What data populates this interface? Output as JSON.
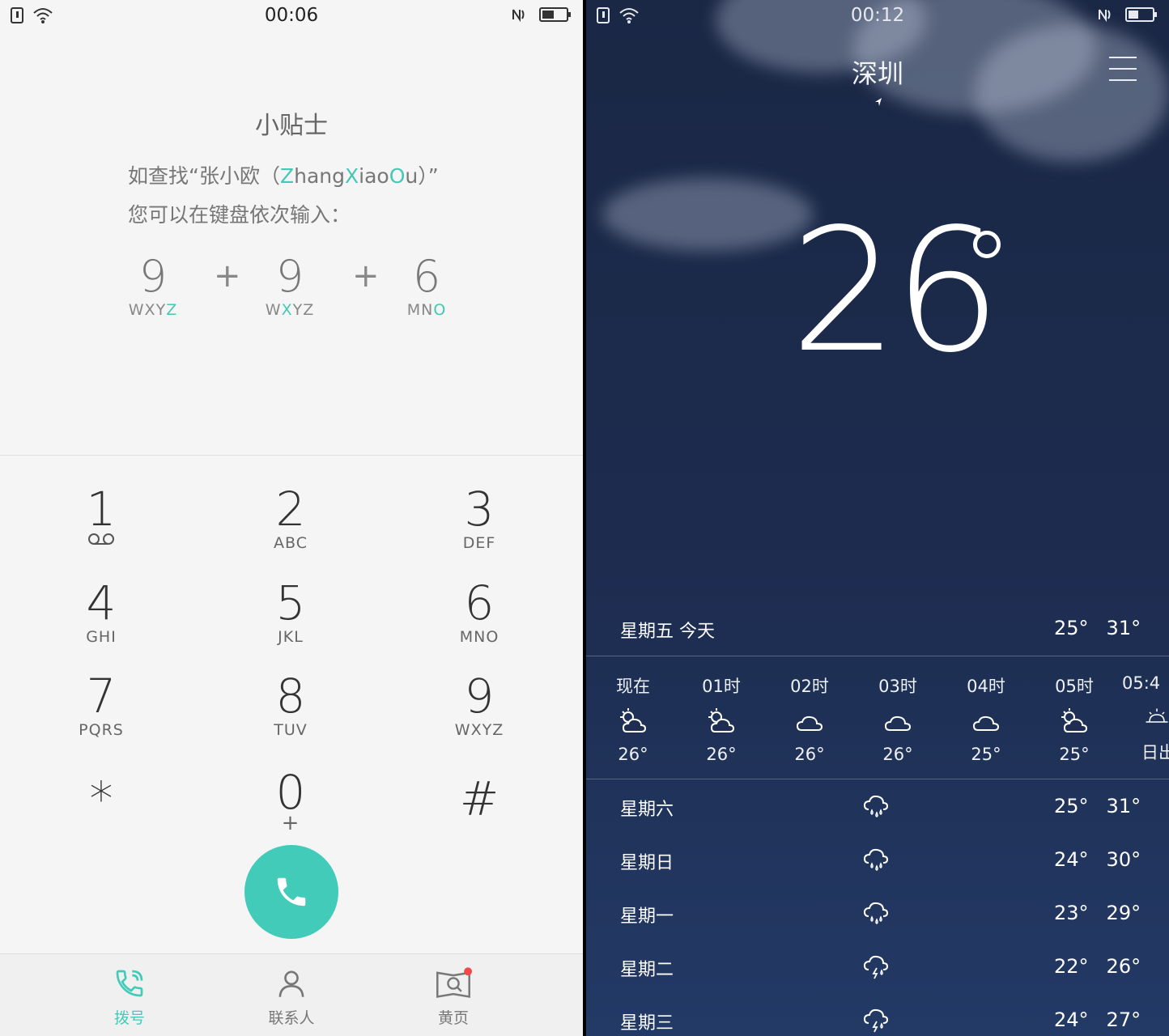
{
  "dialer": {
    "status_time": "00:06",
    "tips": {
      "title": "小贴士",
      "line1_prefix": "如查找“张小欧（",
      "line1_z": "Z",
      "line1_hang": "hang",
      "line1_x": "X",
      "line1_iao": "iao",
      "line1_o": "O",
      "line1_u": "u",
      "line1_suffix": "）”",
      "line2": "您可以在键盘依次输入：",
      "keys": [
        {
          "num": "9",
          "letters_plain": "WXY",
          "letters_hl": "Z",
          "letters_tail": ""
        },
        {
          "num": "9",
          "letters_plain": "W",
          "letters_hl": "X",
          "letters_tail": "YZ"
        },
        {
          "num": "6",
          "letters_plain": "MN",
          "letters_hl": "O",
          "letters_tail": ""
        }
      ],
      "plus": "+"
    },
    "keypad": [
      {
        "num": "1",
        "letters": ""
      },
      {
        "num": "2",
        "letters": "ABC"
      },
      {
        "num": "3",
        "letters": "DEF"
      },
      {
        "num": "4",
        "letters": "GHI"
      },
      {
        "num": "5",
        "letters": "JKL"
      },
      {
        "num": "6",
        "letters": "MNO"
      },
      {
        "num": "7",
        "letters": "PQRS"
      },
      {
        "num": "8",
        "letters": "TUV"
      },
      {
        "num": "9",
        "letters": "WXYZ"
      },
      {
        "num": "*",
        "letters": ""
      },
      {
        "num": "0",
        "letters": "+"
      },
      {
        "num": "#",
        "letters": ""
      }
    ],
    "nav": [
      {
        "label": "拨号",
        "icon": "phone-icon",
        "active": true
      },
      {
        "label": "联系人",
        "icon": "person-icon",
        "active": false
      },
      {
        "label": "黄页",
        "icon": "yellow-pages-icon",
        "active": false
      }
    ],
    "accent_color": "#41cbb8"
  },
  "weather": {
    "status_time": "00:12",
    "city": "深圳",
    "current_temp": "26",
    "today": {
      "day": "星期五  今天",
      "low": "25°",
      "high": "31°"
    },
    "hourly": [
      {
        "time": "现在",
        "icon": "partly-cloudy-icon",
        "temp": "26°"
      },
      {
        "time": "01时",
        "icon": "partly-cloudy-icon",
        "temp": "26°"
      },
      {
        "time": "02时",
        "icon": "cloudy-icon",
        "temp": "26°"
      },
      {
        "time": "03时",
        "icon": "cloudy-icon",
        "temp": "26°"
      },
      {
        "time": "04时",
        "icon": "cloudy-icon",
        "temp": "25°"
      },
      {
        "time": "05时",
        "icon": "partly-cloudy-icon",
        "temp": "25°"
      },
      {
        "time": "05:4",
        "icon": "sunrise-icon",
        "temp": "日出"
      }
    ],
    "daily": [
      {
        "day": "星期六",
        "icon": "rain-icon",
        "low": "25°",
        "high": "31°"
      },
      {
        "day": "星期日",
        "icon": "rain-icon",
        "low": "24°",
        "high": "30°"
      },
      {
        "day": "星期一",
        "icon": "rain-icon",
        "low": "23°",
        "high": "29°"
      },
      {
        "day": "星期二",
        "icon": "thunderstorm-icon",
        "low": "22°",
        "high": "26°"
      },
      {
        "day": "星期三",
        "icon": "thunderstorm-icon",
        "low": "24°",
        "high": "27°"
      }
    ]
  }
}
